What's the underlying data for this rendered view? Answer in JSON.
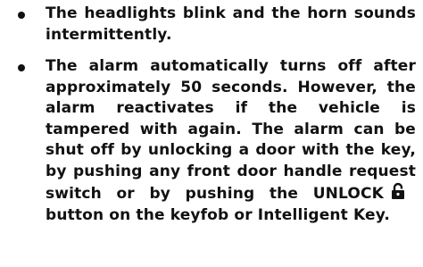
{
  "bullets": [
    {
      "text": "The headlights blink and the horn sounds intermittently."
    },
    {
      "text_before_icon": "The alarm automatically turns off after approximately 50 seconds. However, the alarm reactivates if the vehicle is tampered with again. The alarm can be shut off by unlocking a door with the key, by pushing any front door handle request switch or by pushing the UNLOCK",
      "icon": "unlock-icon",
      "text_after_icon": "button on the keyfob or Intelligent Key."
    }
  ]
}
